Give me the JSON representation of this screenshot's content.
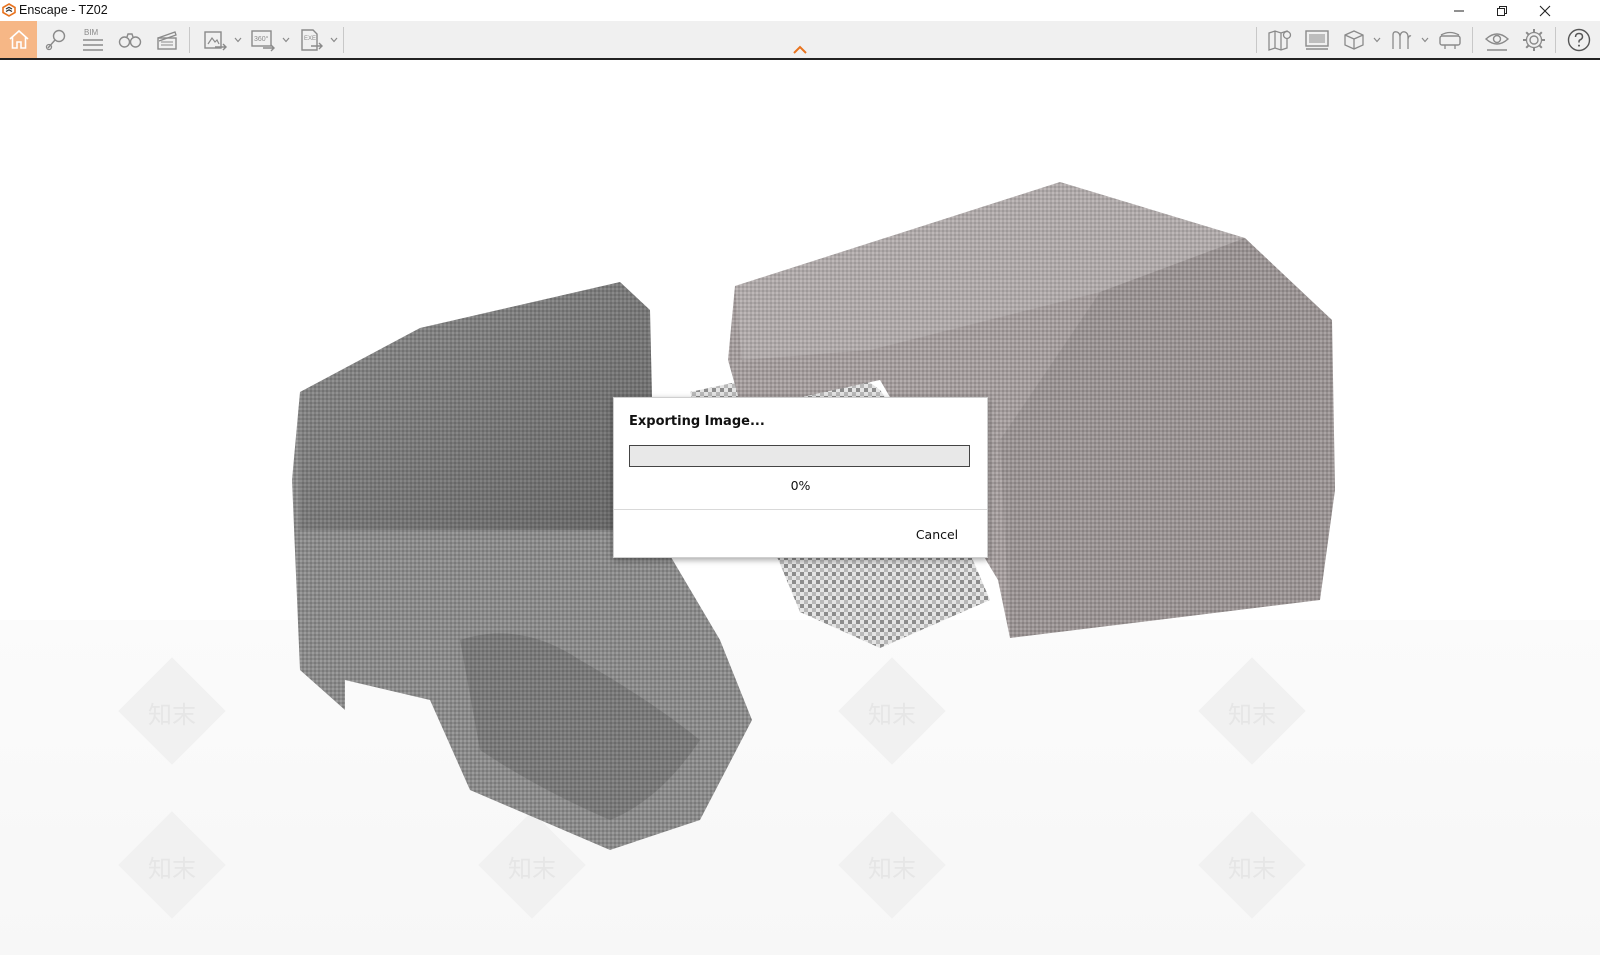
{
  "window": {
    "title": "Enscape - TZ02",
    "controls": {
      "minimize_icon": "minimize-icon",
      "restore_icon": "restore-icon",
      "close_icon": "close-icon"
    }
  },
  "toolbar": {
    "left_tools": [
      {
        "icon": "home-icon",
        "active": true
      },
      {
        "icon": "map-pin-icon"
      },
      {
        "icon": "bim-icon",
        "label": "BIM"
      },
      {
        "icon": "binoculars-icon"
      },
      {
        "icon": "clapperboard-icon"
      },
      {
        "icon": "export-image-icon",
        "dropdown": true
      },
      {
        "icon": "export-360-icon",
        "label": "360°",
        "dropdown": true
      },
      {
        "icon": "export-exe-icon",
        "label": "EXE",
        "dropdown": true
      }
    ],
    "right_tools": [
      {
        "icon": "map-view-icon"
      },
      {
        "icon": "video-editor-icon"
      },
      {
        "icon": "asset-library-icon",
        "dropdown": true
      },
      {
        "icon": "material-icon",
        "dropdown": true
      },
      {
        "icon": "vr-headset-icon"
      },
      {
        "icon": "view-eye-icon"
      },
      {
        "icon": "settings-gear-icon"
      },
      {
        "icon": "help-icon"
      }
    ],
    "collapse_icon": "chevron-up-icon",
    "accent_color": "#e8731e",
    "active_bg": "#f6b786"
  },
  "viewport": {
    "watermark_text": "知末"
  },
  "dialog": {
    "title": "Exporting Image...",
    "progress_percent": 0,
    "progress_text": "0%",
    "cancel_label": "Cancel"
  }
}
